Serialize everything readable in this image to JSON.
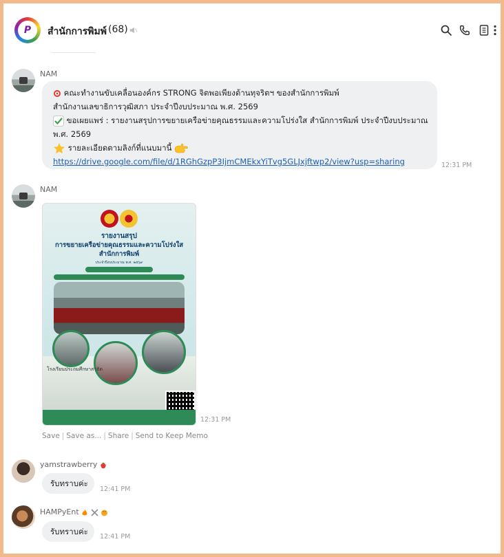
{
  "header": {
    "avatar_text": "P",
    "title": "สำนักการพิมพ์",
    "count": "(68)",
    "icons": [
      "mute-icon",
      "search-icon",
      "phone-icon",
      "notes-icon",
      "more-icon"
    ]
  },
  "messages": [
    {
      "sender": "NAM",
      "lines": [
        "คณะทำงานขับเคลื่อนองค์กร STRONG จิตพอเพียงต้านทุจริตฯ ของสำนักการพิมพ์",
        "สำนักงานเลขาธิการวุฒิสภา ประจำปีงบประมาณ พ.ศ. 2569",
        "ขอเผยแพร่ : รายงานสรุปการขยายเครือข่ายคุณธรรมและความโปร่งใส สำนักการพิมพ์ ประจำปีงบประมาณ",
        "พ.ศ. 2569",
        "รายละเอียดตามลิงก์ที่แนบมานี้"
      ],
      "link": "https://drive.google.com/file/d/1RGhGzpP3IjmCMEkxYiTvg5GLJxjftwp2/view?usp=sharing",
      "time": "12:31 PM"
    },
    {
      "sender": "NAM",
      "poster": {
        "title1": "รายงานสรุป",
        "title2": "การขยายเครือข่ายคุณธรรมและความโปร่งใส",
        "title3": "สำนักการพิมพ์",
        "subtitle": "ประจำปีงบประมาณ พ.ศ. ๒๕๖๙",
        "school_sign": "โรงเรียนประถมศึกษาสาธิต"
      },
      "time": "12:31 PM",
      "actions": [
        "Save",
        "Save as...",
        "Share",
        "Send to Keep Memo"
      ]
    },
    {
      "sender": "yamstrawberry",
      "text": "รับทราบค่ะ",
      "time": "12:41 PM"
    },
    {
      "sender": "HAMPyEnt",
      "text": "รับทราบค่ะ",
      "time": "12:41 PM"
    }
  ],
  "colors": {
    "frame": "#f2b98a",
    "bubble": "#eef0f1",
    "link": "#1a5fb4",
    "poster_green": "#2e8b57"
  }
}
